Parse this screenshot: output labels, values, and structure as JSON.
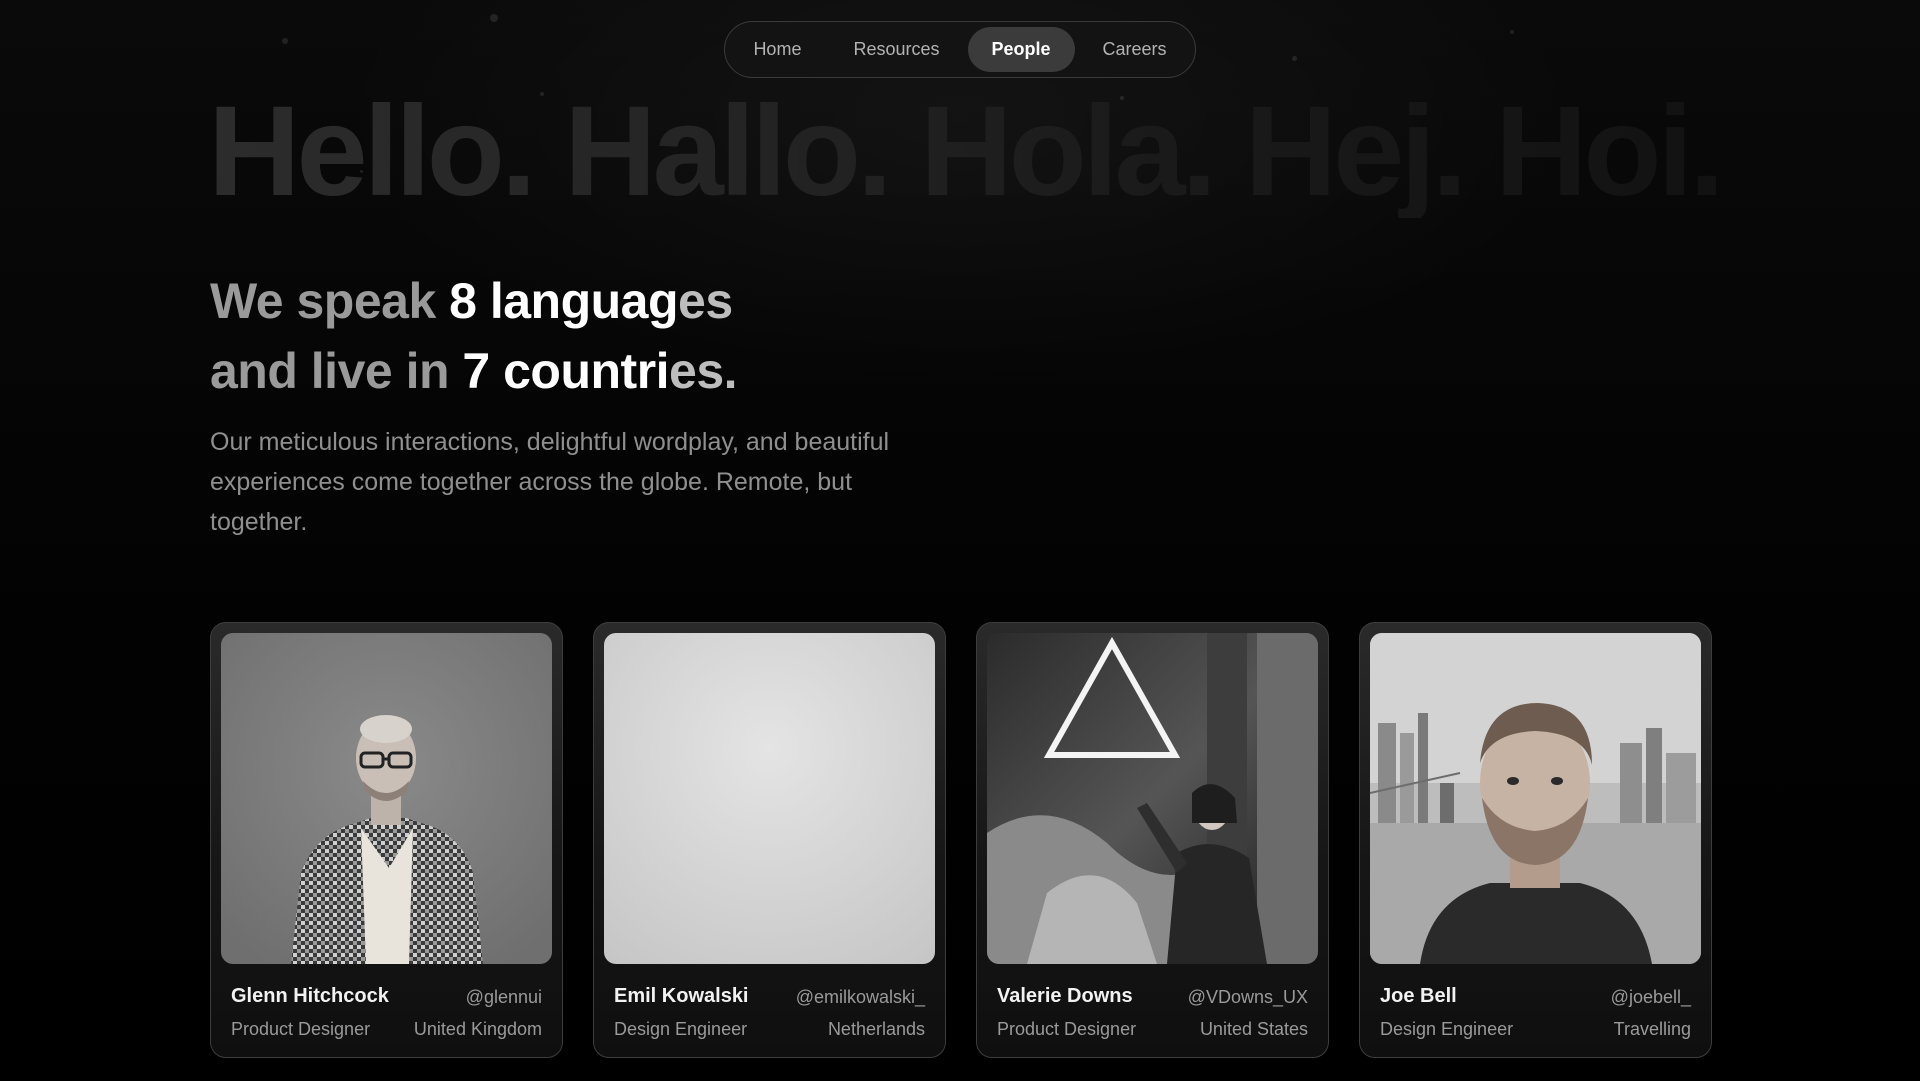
{
  "nav": {
    "items": [
      {
        "label": "Home",
        "active": false
      },
      {
        "label": "Resources",
        "active": false
      },
      {
        "label": "People",
        "active": true
      },
      {
        "label": "Careers",
        "active": false
      }
    ]
  },
  "hero": {
    "greeting": "Hello. Hallo. Hola. Hej. Hoi.",
    "headline": {
      "line1_prefix": "We speak ",
      "line1_highlight": "8 languag",
      "line1_fade": "es",
      "line2_prefix": "and live in ",
      "line2_highlight": "7 countri",
      "line2_fade": "es."
    },
    "subtext": "Our meticulous interactions, delightful wordplay, and beautiful experiences come together across the globe. Remote, but together."
  },
  "people": [
    {
      "name": "Glenn Hitchcock",
      "handle": "@glennui",
      "role": "Product Designer",
      "location": "United Kingdom",
      "photo": "portrait-man-glasses-checked-coat"
    },
    {
      "name": "Emil Kowalski",
      "handle": "@emilkowalski_",
      "role": "Design Engineer",
      "location": "Netherlands",
      "photo": "blank-light-grey"
    },
    {
      "name": "Valerie Downs",
      "handle": "@VDowns_UX",
      "role": "Product Designer",
      "location": "United States",
      "photo": "woman-neon-triangle-rocks"
    },
    {
      "name": "Joe Bell",
      "handle": "@joebell_",
      "role": "Design Engineer",
      "location": "Travelling",
      "photo": "bearded-man-city-skyline"
    }
  ]
}
